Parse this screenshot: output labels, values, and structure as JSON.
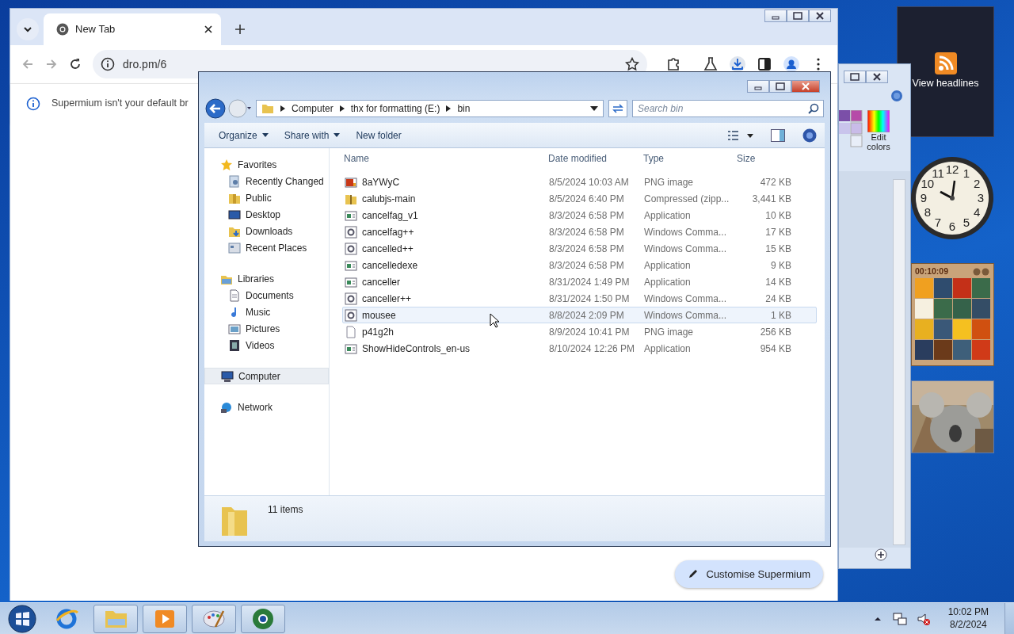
{
  "browser": {
    "tabs": [
      {
        "label": "New Tab",
        "selected": true
      }
    ],
    "address": "dro.pm/6",
    "infobar": "Supermium isn't your default br",
    "customise_button": "Customise Supermium"
  },
  "explorer": {
    "breadcrumb": [
      "Computer",
      "thx for formatting (E:)",
      "bin"
    ],
    "search": {
      "placeholder": "Search bin"
    },
    "toolbar": [
      {
        "label": "Organize",
        "menu": true
      },
      {
        "label": "Share with",
        "menu": true
      },
      {
        "label": "New folder",
        "menu": false
      }
    ],
    "nav": [
      {
        "label": "Favorites",
        "kind": "star",
        "selected": false,
        "children": [
          {
            "label": "Recently Changed",
            "kind": "recent",
            "selected": false
          },
          {
            "label": "Public",
            "kind": "folder",
            "selected": false
          },
          {
            "label": "Desktop",
            "kind": "desktop",
            "selected": false
          },
          {
            "label": "Downloads",
            "kind": "download",
            "selected": false
          },
          {
            "label": "Recent Places",
            "kind": "places",
            "selected": false
          }
        ]
      },
      {
        "label": "Libraries",
        "kind": "library",
        "selected": false,
        "children": [
          {
            "label": "Documents",
            "kind": "document",
            "selected": false
          },
          {
            "label": "Music",
            "kind": "music",
            "selected": false
          },
          {
            "label": "Pictures",
            "kind": "pictures",
            "selected": false
          },
          {
            "label": "Videos",
            "kind": "video",
            "selected": false
          }
        ]
      },
      {
        "label": "Computer",
        "kind": "computer",
        "selected": true
      },
      {
        "label": "Network",
        "kind": "network",
        "selected": false
      }
    ],
    "columns": [
      "Name",
      "Date modified",
      "Type",
      "Size"
    ],
    "rows": [
      {
        "name": "8aYWyC",
        "date": "8/5/2024 10:03 AM",
        "type": "PNG image",
        "size": "472 KB",
        "hovered": false
      },
      {
        "name": "calubjs-main",
        "date": "8/5/2024 6:40 PM",
        "type": "Compressed (zipp...",
        "size": "3,441 KB",
        "kind": "zip",
        "hovered": false
      },
      {
        "name": "cancelfag_v1",
        "date": "8/3/2024 6:58 PM",
        "type": "Application",
        "size": "10 KB",
        "kind": "app",
        "hovered": false
      },
      {
        "name": "cancelfag++",
        "date": "8/3/2024 6:58 PM",
        "type": "Windows Comma...",
        "size": "17 KB",
        "kind": "script",
        "hovered": false
      },
      {
        "name": "cancelled++",
        "date": "8/3/2024 6:58 PM",
        "type": "Windows Comma...",
        "size": "15 KB",
        "kind": "script",
        "hovered": false
      },
      {
        "name": "cancelledexe",
        "date": "8/3/2024 6:58 PM",
        "type": "Application",
        "size": "9 KB",
        "kind": "app",
        "hovered": false
      },
      {
        "name": "canceller",
        "date": "8/31/2024 1:49 PM",
        "type": "Application",
        "size": "14 KB",
        "kind": "app",
        "hovered": false
      },
      {
        "name": "canceller++",
        "date": "8/31/2024 1:50 PM",
        "type": "Windows Comma...",
        "size": "24 KB",
        "kind": "script",
        "hovered": false
      },
      {
        "name": "mousee",
        "date": "8/8/2024 2:09 PM",
        "type": "Windows Comma...",
        "size": "1 KB",
        "kind": "script",
        "hovered": true
      },
      {
        "name": "p41g2h",
        "date": "8/9/2024 10:41 PM",
        "type": "PNG image",
        "size": "256 KB",
        "kind": "blank",
        "hovered": false
      },
      {
        "name": "ShowHideControls_en-us",
        "date": "8/10/2024 12:26 PM",
        "type": "Application",
        "size": "954 KB",
        "kind": "app",
        "hovered": false
      }
    ],
    "status": "11 items"
  },
  "paint": {
    "edit_colors": "Edit colors"
  },
  "gadgets": {
    "feed": "View headlines",
    "clock_numbers": [
      "11",
      "12",
      "1",
      "10",
      "2",
      "9",
      "3",
      "8",
      "4",
      "7",
      "5",
      "6"
    ],
    "puzzle_timer": "00:10:09"
  },
  "taskbar": {
    "items": [
      {
        "kind": "ie",
        "running": false
      },
      {
        "kind": "explorer",
        "running": true
      },
      {
        "kind": "media",
        "running": true
      },
      {
        "kind": "paint",
        "running": true
      },
      {
        "kind": "browser",
        "running": true
      }
    ],
    "time": "10:02 PM",
    "date": "8/2/2024"
  }
}
